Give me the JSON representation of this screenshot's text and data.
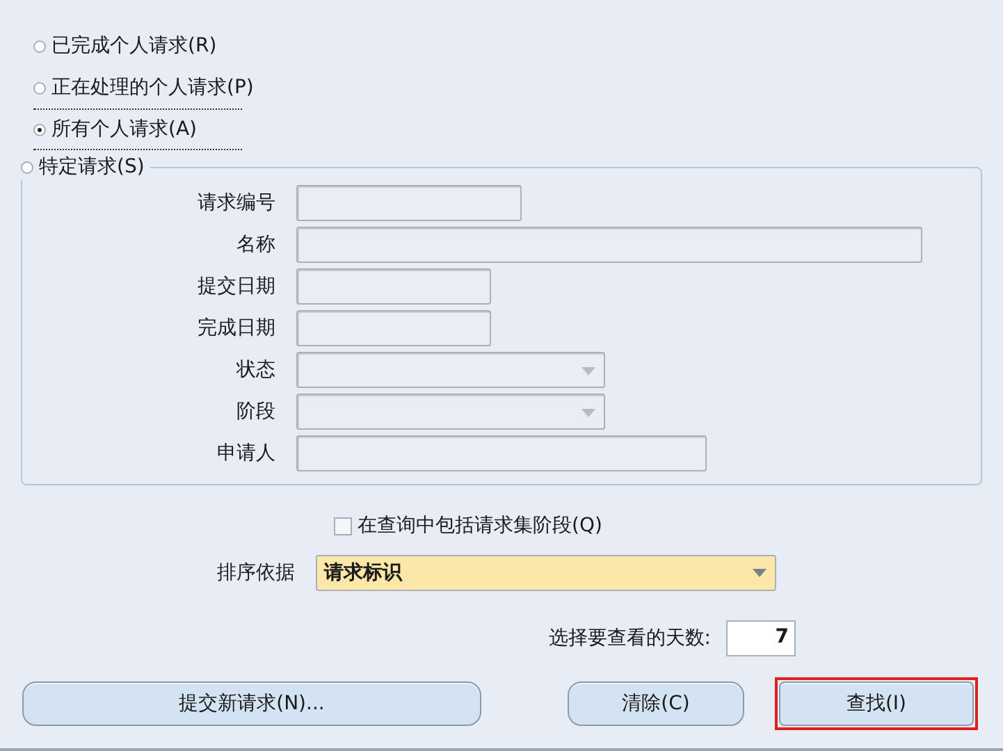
{
  "radios": [
    {
      "label": "已完成个人请求(R)",
      "selected": false,
      "focused": false
    },
    {
      "label": "正在处理的个人请求(P)",
      "selected": false,
      "focused": false
    },
    {
      "label": "所有个人请求(A)",
      "selected": true,
      "focused": true
    }
  ],
  "specific_request": {
    "label": "特定请求(S)",
    "selected": false,
    "fields": [
      {
        "label": "请求编号",
        "kind": "text"
      },
      {
        "label": "名称",
        "kind": "text"
      },
      {
        "label": "提交日期",
        "kind": "text"
      },
      {
        "label": "完成日期",
        "kind": "text"
      },
      {
        "label": "状态",
        "kind": "dropdown"
      },
      {
        "label": "阶段",
        "kind": "dropdown"
      },
      {
        "label": "申请人",
        "kind": "text"
      }
    ]
  },
  "include_request_set": {
    "label": "在查询中包括请求集阶段(Q)",
    "checked": false
  },
  "sort_by": {
    "label": "排序依据",
    "value": "请求标识"
  },
  "days": {
    "label": "选择要查看的天数:",
    "value": "7"
  },
  "buttons": [
    {
      "label": "提交新请求(N)...",
      "highlighted": false
    },
    {
      "label": "清除(C)",
      "highlighted": false
    },
    {
      "label": "查找(I)",
      "highlighted": true
    }
  ]
}
